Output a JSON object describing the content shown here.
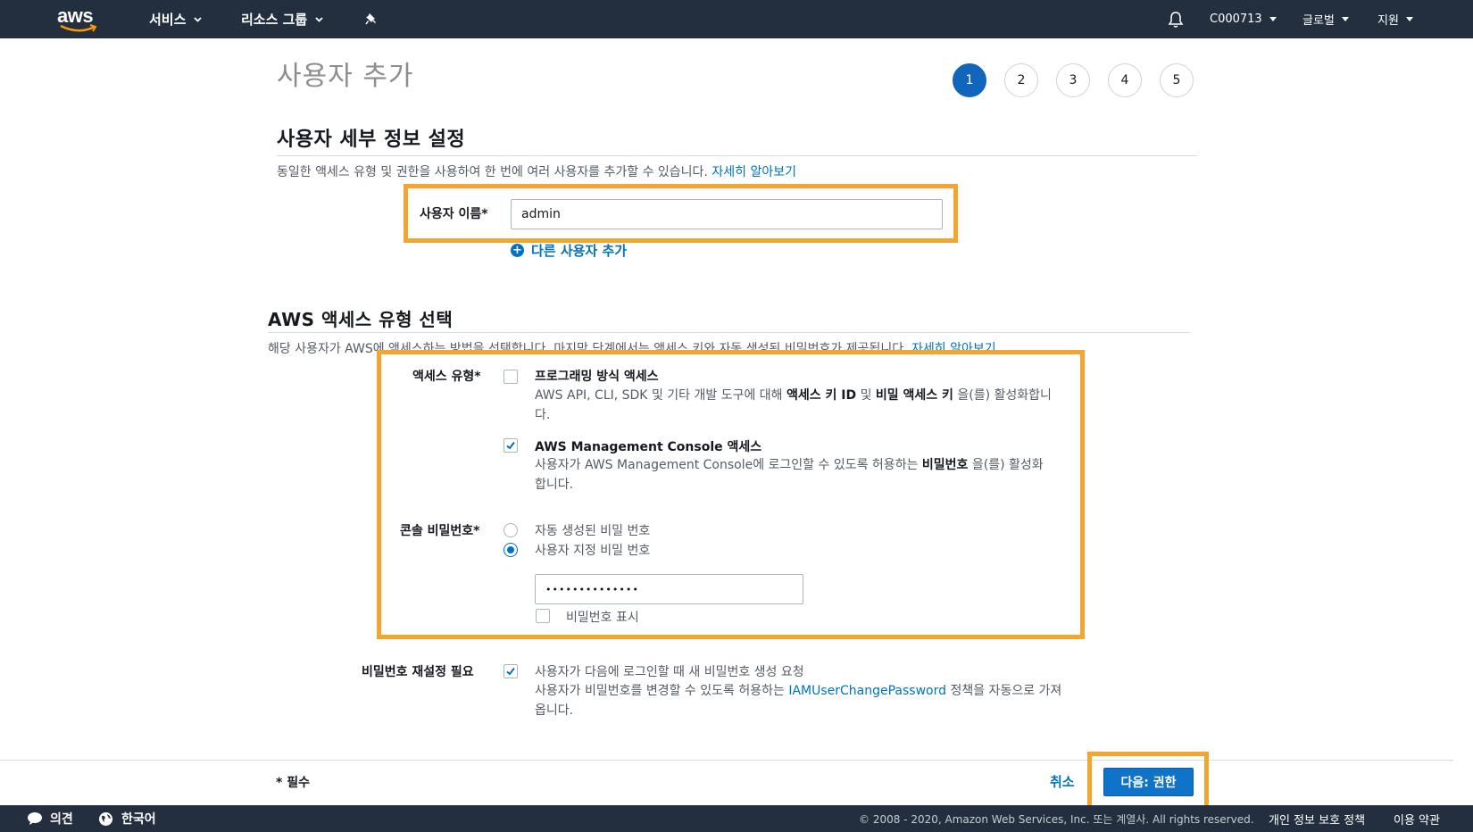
{
  "topnav": {
    "logo": "aws",
    "services": "서비스",
    "resource_groups": "리소스 그룹",
    "pin_icon": "pin-icon",
    "bell_icon": "bell-icon",
    "account": "C000713",
    "region": "글로벌",
    "support": "지원"
  },
  "page": {
    "title": "사용자 추가",
    "steps": [
      "1",
      "2",
      "3",
      "4",
      "5"
    ],
    "active_step": "1"
  },
  "details": {
    "title": "사용자 세부 정보 설정",
    "description": "동일한 액세스 유형 및 권한을 사용하여 한 번에 여러 사용자를 추가할 수 있습니다.",
    "learn_more": "자세히 알아보기",
    "username_label": "사용자 이름*",
    "username_value": "admin",
    "add_another": "다른 사용자 추가"
  },
  "access": {
    "title": "AWS 액세스 유형 선택",
    "description": "해당 사용자가 AWS에 액세스하는 방법을 선택합니다. 마지막 단계에서는 액세스 키와 자동 생성된 비밀번호가 제공됩니다.",
    "learn_more": "자세히 알아보기",
    "type_label": "액세스 유형*",
    "programmatic": {
      "title": "프로그래밍 방식 액세스",
      "desc_1": "AWS API, CLI, SDK 및 기타 개발 도구에 대해",
      "key_id": "액세스 키 ID",
      "and": "및",
      "secret": "비밀 액세스 키",
      "desc_2": "을(를) 활성화합니다.",
      "checked": false
    },
    "console": {
      "title": "AWS Management Console 액세스",
      "desc_1": "사용자가 AWS Management Console에 로그인할 수 있도록 허용하는",
      "password": "비밀번호",
      "desc_2": "을(를) 활성화합니다.",
      "checked": true
    },
    "console_pw_label": "콘솔 비밀번호*",
    "pw_auto": "자동 생성된 비밀 번호",
    "pw_custom": "사용자 지정 비밀 번호",
    "pw_value": "••••••••••••••",
    "show_pw": "비밀번호 표시"
  },
  "reset": {
    "label": "비밀번호 재설정 필요",
    "line1": "사용자가 다음에 로그인할 때 새 비밀번호 생성 요청",
    "line2_a": "사용자가 비밀번호를 변경할 수 있도록 허용하는",
    "policy": "IAMUserChangePassword",
    "line2_b": "정책을 자동으로 가져옵니다.",
    "checked": true
  },
  "footer": {
    "required": "* 필수",
    "cancel": "취소",
    "next": "다음: 권한"
  },
  "bottombar": {
    "feedback": "의견",
    "language": "한국어",
    "copyright": "© 2008 - 2020, Amazon Web Services, Inc. 또는 계열사. All rights reserved.",
    "privacy": "개인 정보 보호 정책",
    "terms": "이용 약관"
  },
  "colors": {
    "nav_bg": "#232f3e",
    "accent_blue": "#0073bb",
    "highlight_orange": "#f3a531"
  }
}
